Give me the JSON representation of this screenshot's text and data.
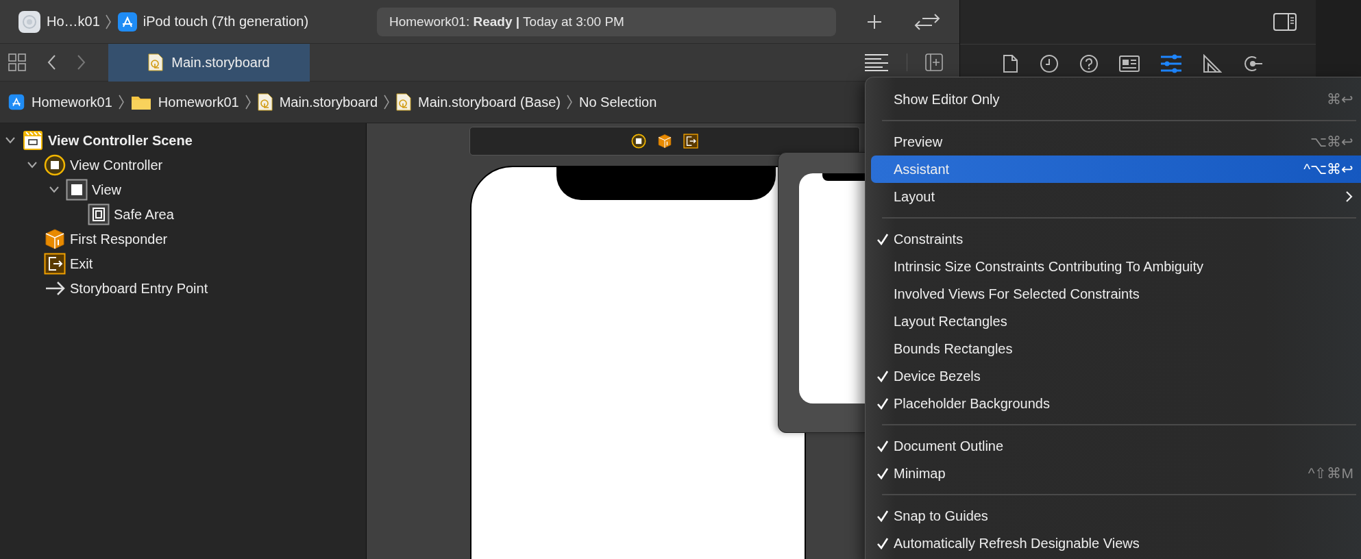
{
  "toolbar": {
    "scheme": "Ho…k01",
    "destination": "iPod touch (7th generation)",
    "status": "Homework01: **Ready |** Today at 3:00 PM"
  },
  "editor_tabs": [
    {
      "label": "Main.storyboard",
      "selected": true
    }
  ],
  "jump_bar": [
    {
      "kind": "project",
      "label": "Homework01"
    },
    {
      "kind": "folder",
      "label": "Homework01"
    },
    {
      "kind": "storyboard",
      "label": "Main.storyboard"
    },
    {
      "kind": "storyboard",
      "label": "Main.storyboard (Base)"
    },
    {
      "kind": "plain",
      "label": "No Selection"
    }
  ],
  "inspector_tabs": [
    {
      "kind": "file",
      "selected": false
    },
    {
      "kind": "history",
      "selected": false
    },
    {
      "kind": "help",
      "selected": false
    },
    {
      "kind": "identity",
      "selected": false
    },
    {
      "kind": "attributes",
      "selected": true
    },
    {
      "kind": "size",
      "selected": false
    },
    {
      "kind": "connections",
      "selected": false
    }
  ],
  "outline": [
    {
      "kind": "scene",
      "label": "View Controller Scene",
      "expanded": true,
      "children": [
        {
          "kind": "controller",
          "label": "View Controller",
          "expanded": true,
          "children": [
            {
              "kind": "view",
              "label": "View",
              "expanded": true,
              "children": [
                {
                  "kind": "safe-area",
                  "label": "Safe Area"
                }
              ]
            }
          ]
        },
        {
          "kind": "responder",
          "label": "First Responder"
        },
        {
          "kind": "exit",
          "label": "Exit"
        },
        {
          "kind": "entry",
          "label": "Storyboard Entry Point"
        }
      ]
    }
  ],
  "menu": [
    {
      "kind": "item",
      "label": "Show Editor Only",
      "shortcut": "⌘↩",
      "checked": false,
      "selected": false
    },
    {
      "kind": "separator"
    },
    {
      "kind": "item",
      "label": "Preview",
      "shortcut": "⌥⌘↩",
      "checked": false,
      "selected": false
    },
    {
      "kind": "item",
      "label": "Assistant",
      "shortcut": "^⌥⌘↩",
      "checked": false,
      "selected": true
    },
    {
      "kind": "item",
      "label": "Layout",
      "submenu": true,
      "checked": false,
      "selected": false
    },
    {
      "kind": "separator"
    },
    {
      "kind": "item",
      "label": "Constraints",
      "checked": true,
      "selected": false
    },
    {
      "kind": "item",
      "label": "Intrinsic Size Constraints Contributing To Ambiguity",
      "checked": false,
      "selected": false
    },
    {
      "kind": "item",
      "label": "Involved Views For Selected Constraints",
      "checked": false,
      "selected": false
    },
    {
      "kind": "item",
      "label": "Layout Rectangles",
      "checked": false,
      "selected": false
    },
    {
      "kind": "item",
      "label": "Bounds Rectangles",
      "checked": false,
      "selected": false
    },
    {
      "kind": "item",
      "label": "Device Bezels",
      "checked": true,
      "selected": false
    },
    {
      "kind": "item",
      "label": "Placeholder Backgrounds",
      "checked": true,
      "selected": false
    },
    {
      "kind": "separator"
    },
    {
      "kind": "item",
      "label": "Document Outline",
      "checked": true,
      "selected": false
    },
    {
      "kind": "item",
      "label": "Minimap",
      "shortcut": "^⇧⌘M",
      "checked": true,
      "selected": false
    },
    {
      "kind": "separator"
    },
    {
      "kind": "item",
      "label": "Snap to Guides",
      "checked": true,
      "selected": false
    },
    {
      "kind": "item",
      "label": "Automatically Refresh Designable Views",
      "checked": true,
      "selected": false
    }
  ]
}
